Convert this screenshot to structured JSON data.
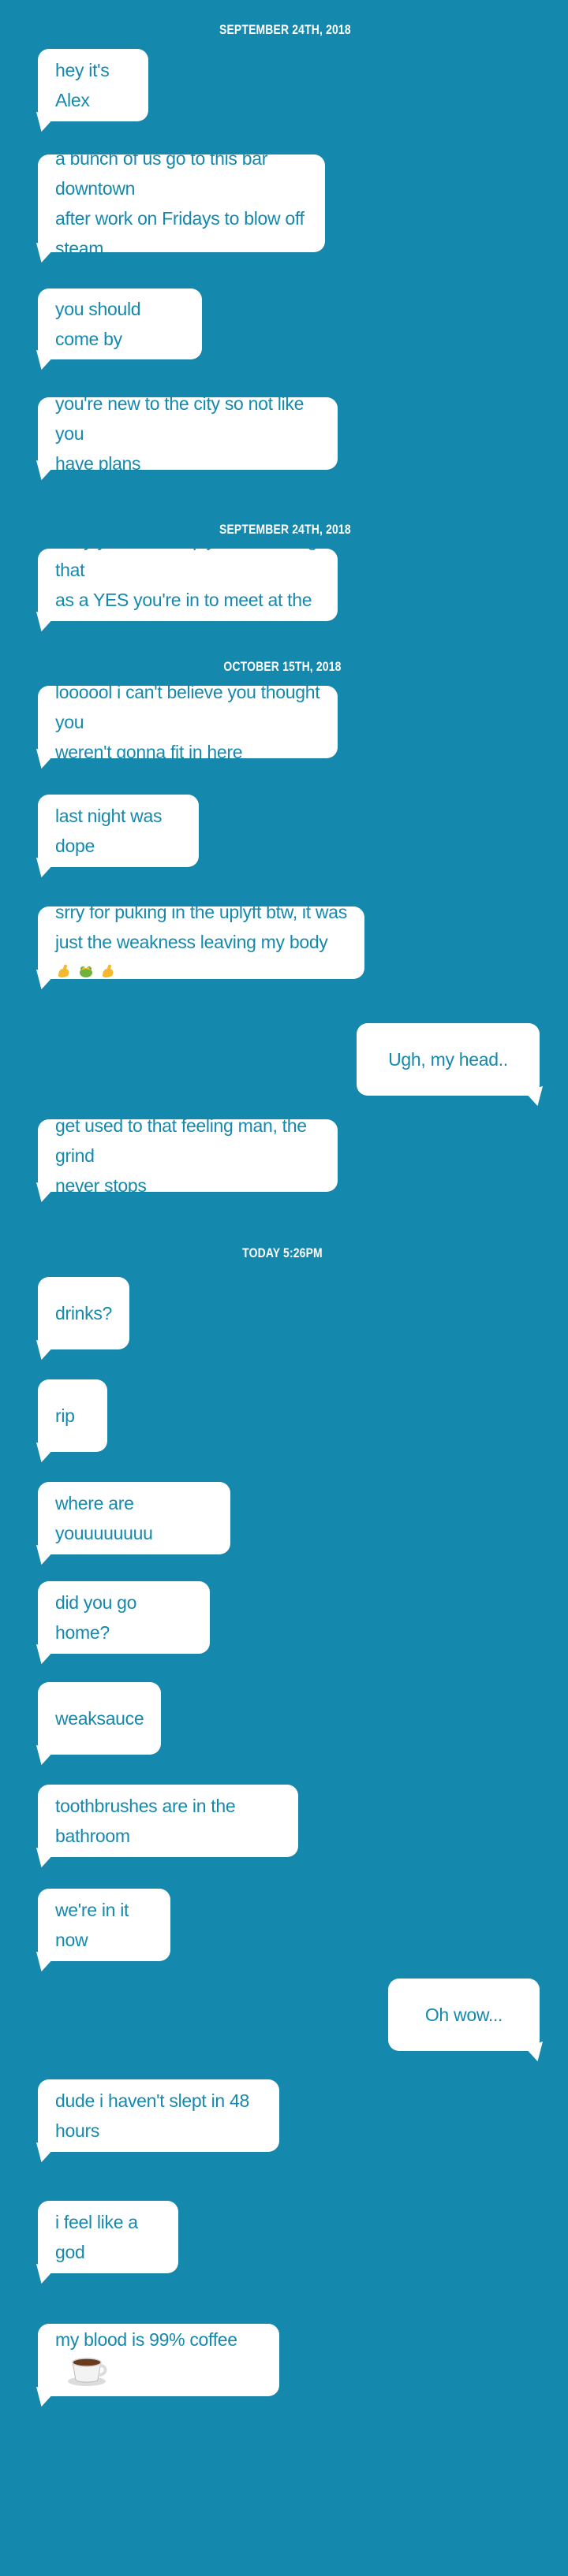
{
  "colors": {
    "background": "#1589ad",
    "bubble": "#ffffff",
    "bubble_text": "#1589ad",
    "timestamp_text": "#ffffff"
  },
  "timestamps": [
    "SEPTEMBER 24TH, 2018",
    "SEPTEMBER 24TH, 2018",
    "OCTOBER 15TH, 2018",
    "TODAY 5:26PM"
  ],
  "messages": [
    {
      "side": "incoming",
      "text": "hey it's Alex"
    },
    {
      "side": "incoming",
      "lines": [
        "a bunch of us go to this bar downtown",
        "after work on Fridays to blow off",
        "steam"
      ]
    },
    {
      "side": "incoming",
      "text": "you should come by"
    },
    {
      "side": "incoming",
      "lines": [
        "you're new to the city so not like you",
        "have plans"
      ]
    },
    {
      "side": "incoming",
      "lines": [
        "okay you didn't reply so i'm taking that",
        "as a YES you're in to meet at the place"
      ]
    },
    {
      "side": "incoming",
      "lines": [
        "loooool i can't believe you thought you",
        "weren't gonna fit in here"
      ]
    },
    {
      "side": "incoming",
      "text": "last night was dope"
    },
    {
      "side": "incoming",
      "lines": [
        " srry for puking in the uplyft btw, it was",
        "just the weakness leaving my body"
      ],
      "emoji": [
        "flexed-biceps-emoji",
        "frog-emoji",
        "flexed-biceps-emoji"
      ]
    },
    {
      "side": "outgoing",
      "text": "Ugh, my head.."
    },
    {
      "side": "incoming",
      "lines": [
        "get used to that feeling man, the grind",
        "never stops"
      ]
    },
    {
      "side": "incoming",
      "text": "drinks?"
    },
    {
      "side": "incoming",
      "text": "rip"
    },
    {
      "side": "incoming",
      "text": " where are youuuuuuuu"
    },
    {
      "side": "incoming",
      "text": "did you go home?"
    },
    {
      "side": "incoming",
      "text": "weaksauce"
    },
    {
      "side": "incoming",
      "text": "toothbrushes are in the bathroom"
    },
    {
      "side": "incoming",
      "text": "we're in it now"
    },
    {
      "side": "outgoing",
      "text": "Oh wow..."
    },
    {
      "side": "incoming",
      "text": "dude i haven't slept in 48 hours"
    },
    {
      "side": "incoming",
      "text": "i feel like a god"
    },
    {
      "side": "incoming",
      "text": "my blood is 99% coffee",
      "emoji": [
        "coffee-cup-emoji"
      ]
    }
  ]
}
